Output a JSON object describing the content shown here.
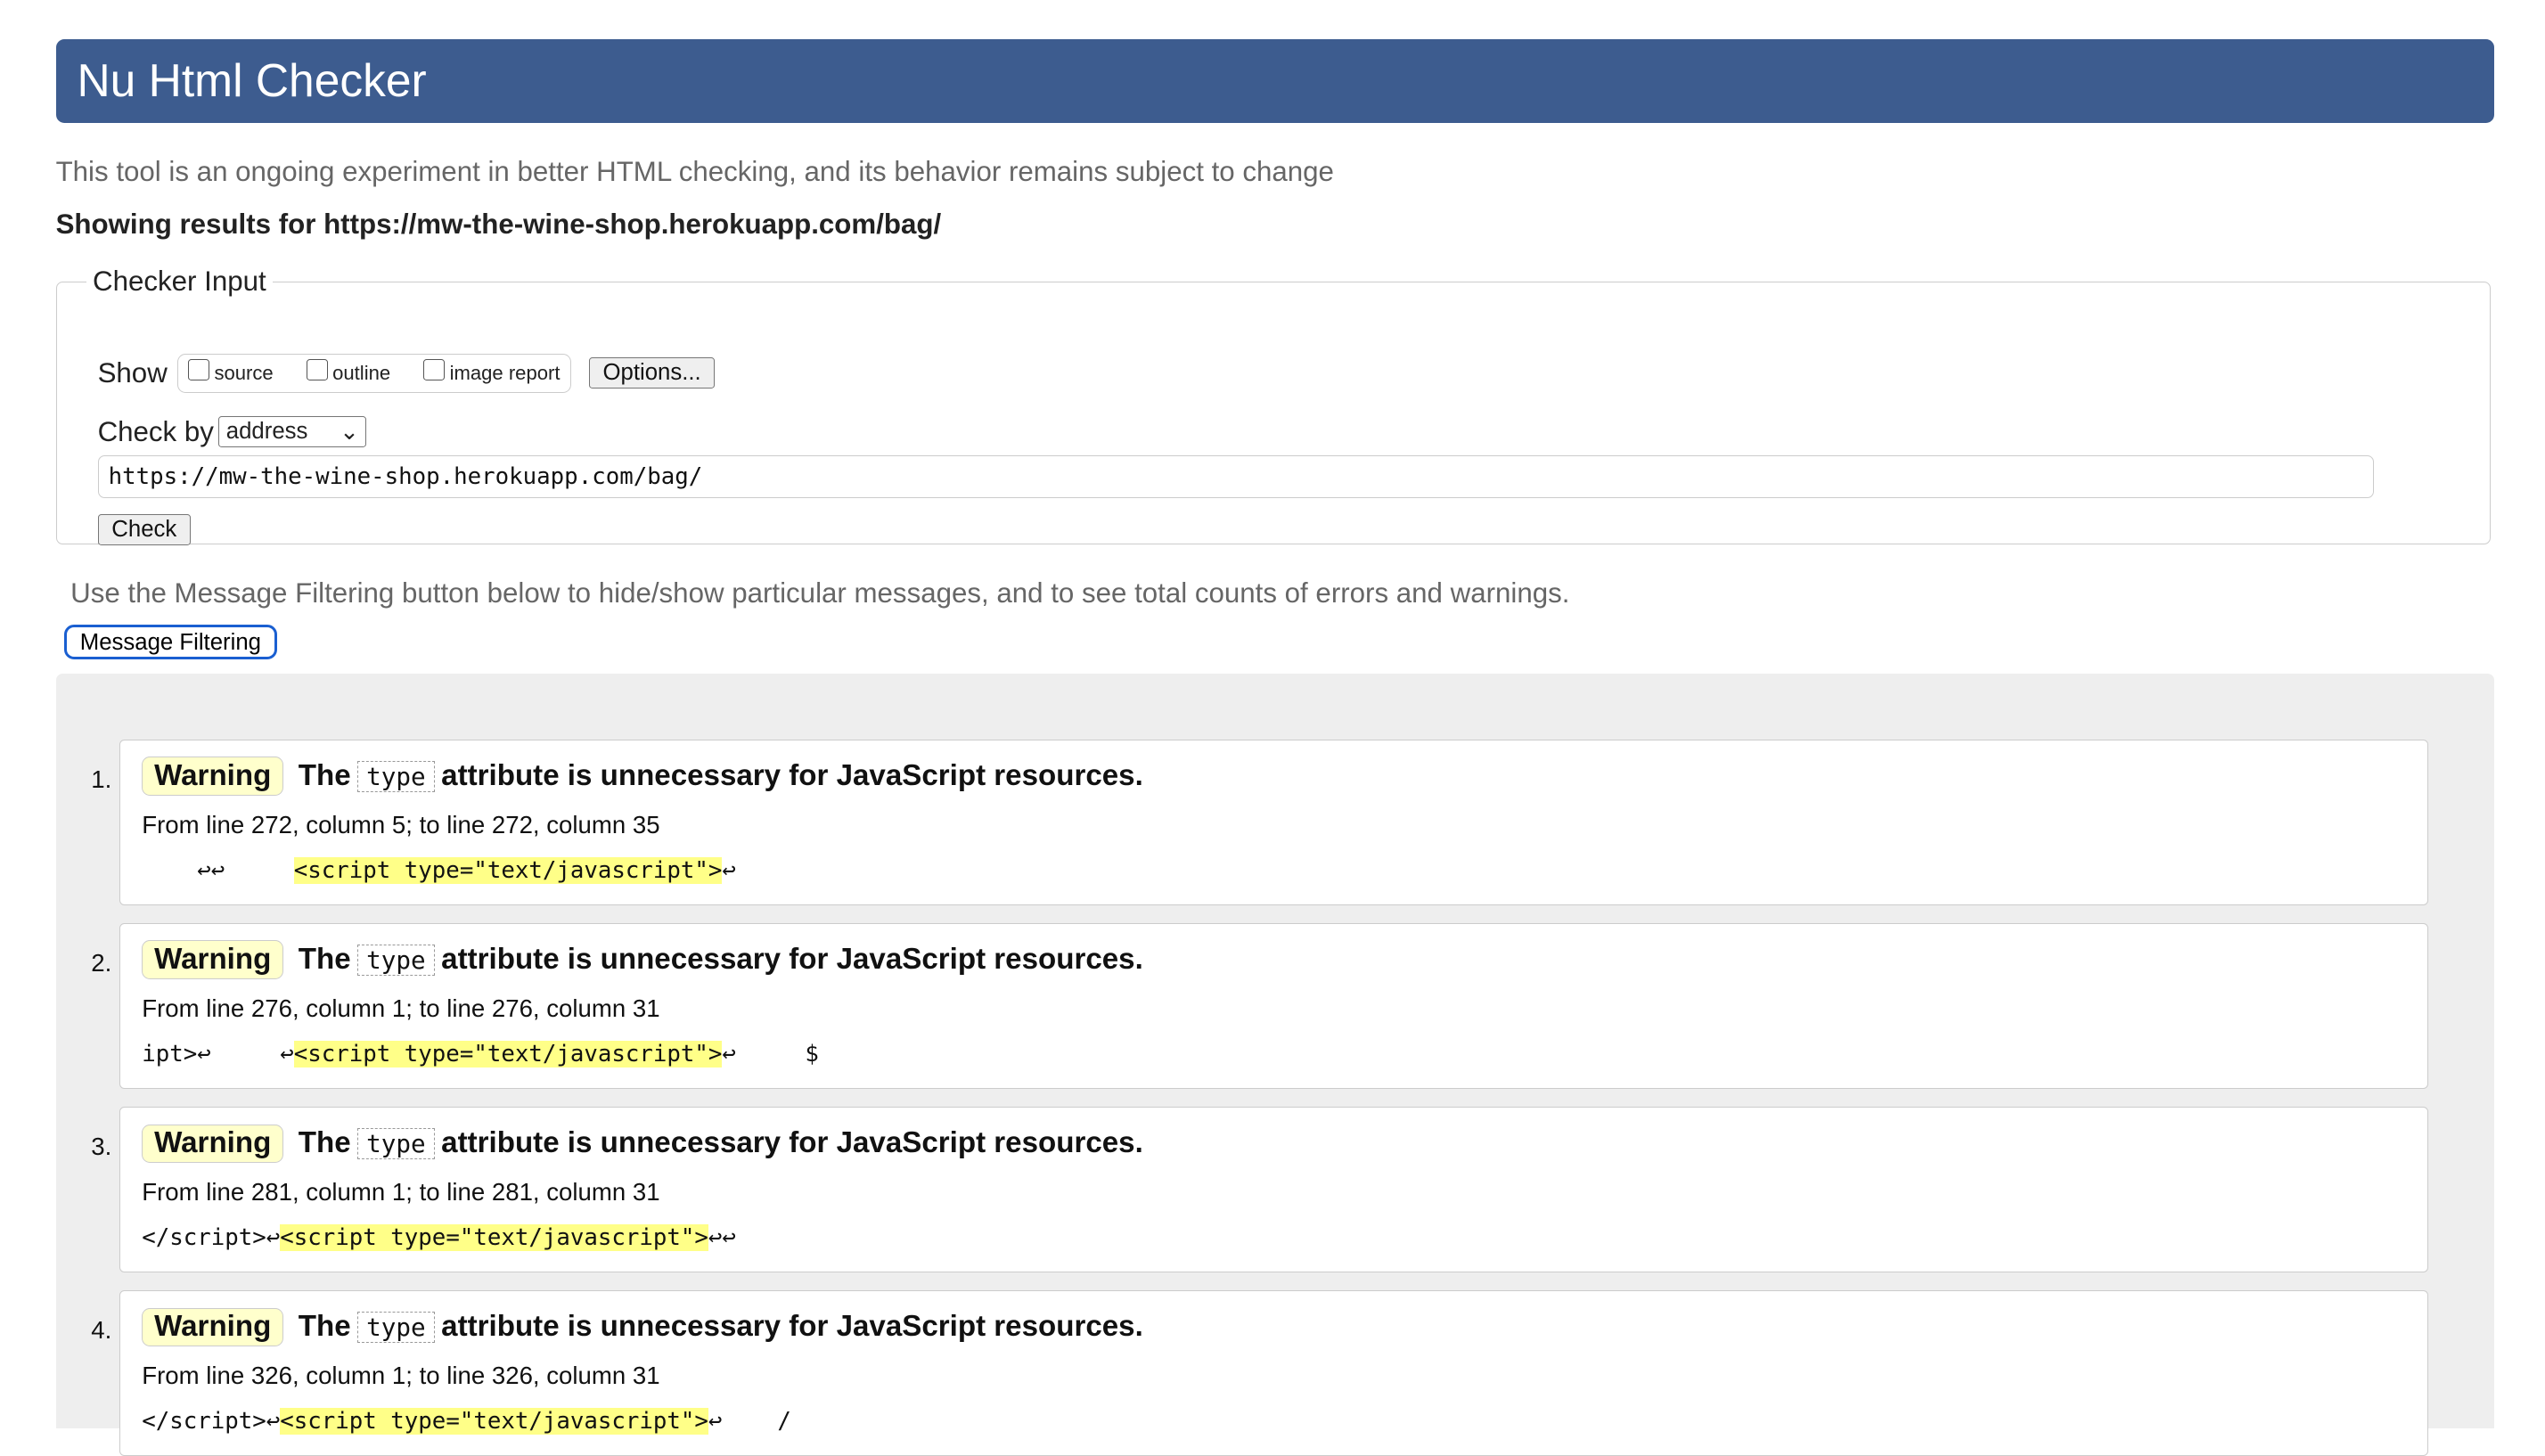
{
  "header": {
    "title": "Nu Html Checker"
  },
  "intro": "This tool is an ongoing experiment in better HTML checking, and its behavior remains subject to change",
  "showing": "Showing results for https://mw-the-wine-shop.herokuapp.com/bag/",
  "checker": {
    "legend": "Checker Input",
    "show_label": "Show",
    "options": [
      {
        "label": "source",
        "checked": false
      },
      {
        "label": "outline",
        "checked": false
      },
      {
        "label": "image report",
        "checked": false
      }
    ],
    "options_button": "Options...",
    "check_by_label": "Check by",
    "check_by_value": "address",
    "url": "https://mw-the-wine-shop.herokuapp.com/bag/",
    "check_button": "Check"
  },
  "filter": {
    "text": "Use the Message Filtering button below to hide/show particular messages, and to see total counts of errors and warnings.",
    "button": "Message Filtering"
  },
  "messages": [
    {
      "num": "1.",
      "type": "Warning",
      "pre": "The",
      "code": "type",
      "post": "attribute is unnecessary for JavaScript resources.",
      "location": "From line 272, column 5; to line 272, column 35",
      "before": "    ↩↩     ",
      "highlight": "<script type=\"text/javascript\">",
      "after": "↩"
    },
    {
      "num": "2.",
      "type": "Warning",
      "pre": "The",
      "code": "type",
      "post": "attribute is unnecessary for JavaScript resources.",
      "location": "From line 276, column 1; to line 276, column 31",
      "before": "ipt>↩     ↩",
      "highlight": "<script type=\"text/javascript\">",
      "after": "↩     $"
    },
    {
      "num": "3.",
      "type": "Warning",
      "pre": "The",
      "code": "type",
      "post": "attribute is unnecessary for JavaScript resources.",
      "location": "From line 281, column 1; to line 281, column 31",
      "before": "</script>↩",
      "highlight": "<script type=\"text/javascript\">",
      "after": "↩↩"
    },
    {
      "num": "4.",
      "type": "Warning",
      "pre": "The",
      "code": "type",
      "post": "attribute is unnecessary for JavaScript resources.",
      "location": "From line 326, column 1; to line 326, column 31",
      "before": "</script>↩",
      "highlight": "<script type=\"text/javascript\">",
      "after": "↩    /"
    }
  ]
}
